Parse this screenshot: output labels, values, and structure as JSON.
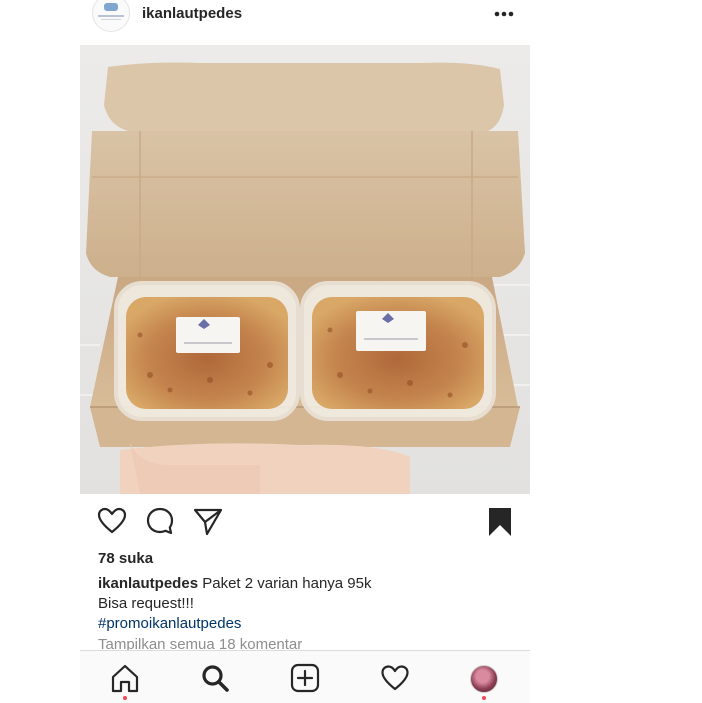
{
  "post": {
    "username": "ikanlautpedes",
    "likes": "78 suka",
    "caption_user": "ikanlautpedes",
    "caption_text": "Paket 2 varian hanya 95k",
    "caption_line2": "Bisa request!!!",
    "hashtag": "#promoikanlautpedes",
    "view_comments": "Tampilkan semua 18 komentar"
  },
  "icons": {
    "header": [
      "avatar",
      "more-icon"
    ],
    "actions": [
      "heart-icon",
      "comment-icon",
      "share-icon",
      "bookmark-icon"
    ],
    "tabbar": [
      "home-icon",
      "search-icon",
      "add-post-icon",
      "activity-heart-icon",
      "profile-avatar"
    ]
  },
  "colors": {
    "text": "#262626",
    "secondary_text": "#8e8e8e",
    "hashtag": "#003569",
    "notification_dot": "#ed4956",
    "tabbar_bg": "#fafafa"
  }
}
